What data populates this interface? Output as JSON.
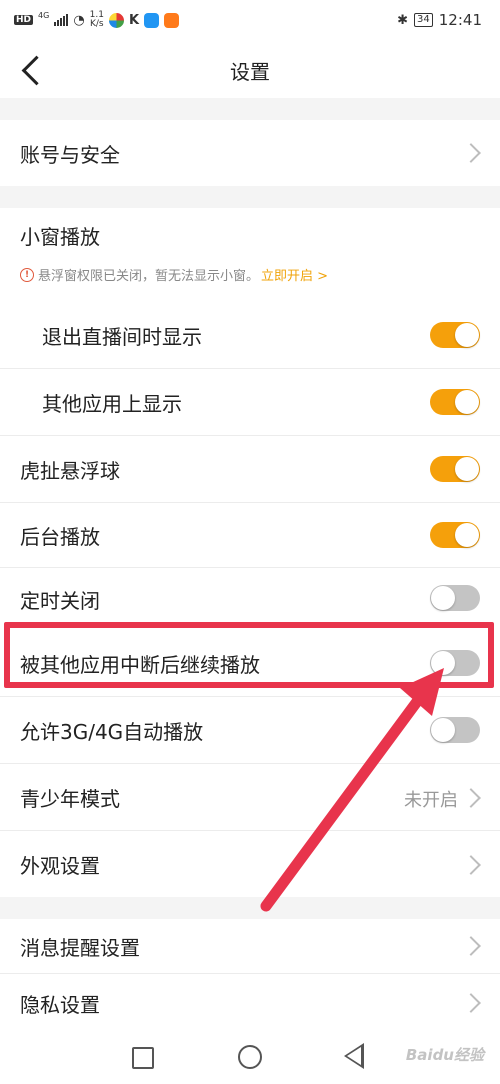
{
  "status_bar": {
    "network": "HD",
    "network_type": "4G",
    "speed_value": "1.1",
    "speed_unit": "K/s",
    "battery": "34",
    "time": "12:41"
  },
  "header": {
    "title": "设置"
  },
  "rows": {
    "account": {
      "label": "账号与安全"
    },
    "mini_window": {
      "label": "小窗播放"
    },
    "warning": {
      "text": "悬浮窗权限已关闭，暂无法显示小窗。",
      "link": "立即开启 >"
    },
    "exit_live": {
      "label": "退出直播间时显示",
      "enabled": true
    },
    "other_apps": {
      "label": "其他应用上显示",
      "enabled": true
    },
    "float_ball": {
      "label": "虎扯悬浮球",
      "enabled": true
    },
    "background_play": {
      "label": "后台播放",
      "enabled": true
    },
    "timer_close": {
      "label": "定时关闭",
      "enabled": false
    },
    "resume_after_interrupt": {
      "label": "被其他应用中断后继续播放",
      "enabled": false
    },
    "mobile_autoplay": {
      "label": "允许3G/4G自动播放",
      "enabled": false
    },
    "teen_mode": {
      "label": "青少年模式",
      "value": "未开启"
    },
    "appearance": {
      "label": "外观设置"
    },
    "notifications": {
      "label": "消息提醒设置"
    },
    "privacy": {
      "label": "隐私设置"
    }
  },
  "watermark": "Baidu经验",
  "colors": {
    "accent": "#f5a00b",
    "highlight": "#e8344c",
    "toggle_off": "#c4c4c4"
  }
}
